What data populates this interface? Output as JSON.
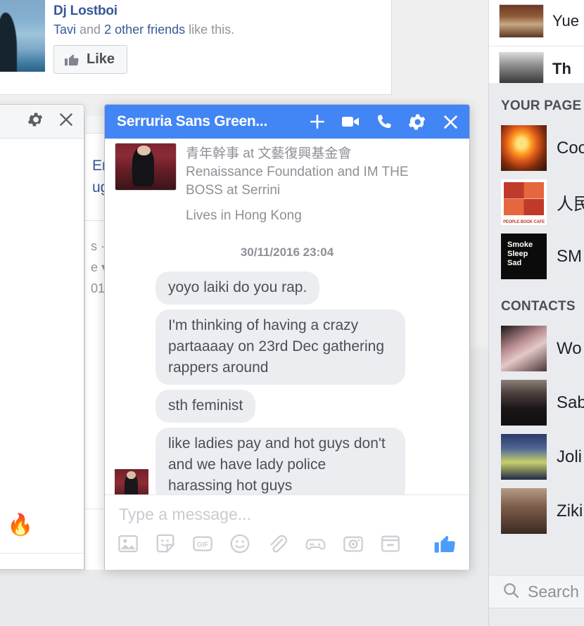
{
  "feed_post": {
    "author": "Dj Lostboi",
    "likes_prefix": "Tavi",
    "likes_middle": " and ",
    "likes_link": "2 other friends",
    "likes_suffix": " like this.",
    "like_button_label": "Like",
    "like_icon": "thumbs-up-icon",
    "avatar_alt": "profile-photo"
  },
  "left_window": {
    "gear_icon": "gear-icon",
    "close_icon": "close-icon",
    "poll_icon": "poll-chart-icon",
    "fire_emoji": "🔥"
  },
  "under_card": {
    "line1": "Eng",
    "line2": "ugu",
    "meta1": "s ·",
    "meta2": "e ▾",
    "meta3": "01"
  },
  "chat_window": {
    "title": "Serruria Sans Green...",
    "header_icons": [
      {
        "name": "add-person-icon",
        "label": "Add people"
      },
      {
        "name": "video-call-icon",
        "label": "Start a video call"
      },
      {
        "name": "phone-call-icon",
        "label": "Start a call"
      },
      {
        "name": "gear-icon",
        "label": "Options"
      },
      {
        "name": "close-icon",
        "label": "Close"
      }
    ],
    "profile": {
      "line1_cjk": "青年幹事",
      "line1_at": " at ",
      "line1_cjk2": "文藝復興基金會",
      "line2": "Renaissance Foundation and IM THE",
      "line3": "BOSS at Serrini",
      "line4": "Lives in Hong Kong"
    },
    "timestamp": "30/11/2016 23:04",
    "messages": [
      {
        "text": "yoyo laiki do you rap.",
        "show_avatar": false
      },
      {
        "text": "I'm thinking of having a crazy partaaaay on 23rd Dec gathering rappers around",
        "show_avatar": false
      },
      {
        "text": "sth feminist",
        "show_avatar": false
      },
      {
        "text": "like ladies pay and hot guys don't and we have lady police harassing hot guys",
        "show_avatar": true
      }
    ],
    "composer": {
      "value": "",
      "placeholder": "Type a message...",
      "tools": [
        {
          "name": "photo-icon",
          "label": "Add photo"
        },
        {
          "name": "sticker-icon",
          "label": "Choose a sticker"
        },
        {
          "name": "gif-icon",
          "label": "Choose a GIF",
          "text": "GIF"
        },
        {
          "name": "emoji-icon",
          "label": "Choose an emoji"
        },
        {
          "name": "attachment-icon",
          "label": "Attach a file"
        },
        {
          "name": "gamepad-icon",
          "label": "Play a game"
        },
        {
          "name": "camera-icon",
          "label": "Take a photo"
        },
        {
          "name": "payment-icon",
          "label": "Send money"
        }
      ],
      "like_tool": {
        "name": "thumbs-up-icon",
        "label": "Send a Like"
      }
    }
  },
  "right_rail": {
    "top_rows": [
      {
        "label": "Yue",
        "bold": false,
        "art": "t-yue"
      },
      {
        "label": "Th",
        "bold": true,
        "art": "t-wear"
      }
    ],
    "sections": [
      {
        "heading": "YOUR PAGE",
        "items": [
          {
            "name": "Coo",
            "art": "a-cook",
            "cjk": false
          },
          {
            "name": "人民",
            "art": "a-people",
            "cjk": true
          },
          {
            "name": "SM",
            "art": "a-smoke",
            "cjk": false
          }
        ]
      },
      {
        "heading": "CONTACTS",
        "items": [
          {
            "name": "Wo",
            "art": "a-won",
            "cjk": false
          },
          {
            "name": "Sab",
            "art": "a-sab",
            "cjk": false
          },
          {
            "name": "Joli",
            "art": "a-joli",
            "cjk": false
          },
          {
            "name": "Ziki",
            "art": "a-ziki",
            "cjk": false
          }
        ]
      }
    ],
    "search": {
      "placeholder": "Search",
      "icon": "search-icon"
    },
    "smoke_card_lines": "Smoke\nSleep\nSad"
  },
  "colors": {
    "messenger_blue": "#4285f4",
    "bubble_gray": "#ebedf0",
    "link_blue": "#365899",
    "text_dark": "#1d2129",
    "text_muted": "#90949c",
    "rail_bg": "#e9ebee",
    "page_bg": "#efefef"
  }
}
